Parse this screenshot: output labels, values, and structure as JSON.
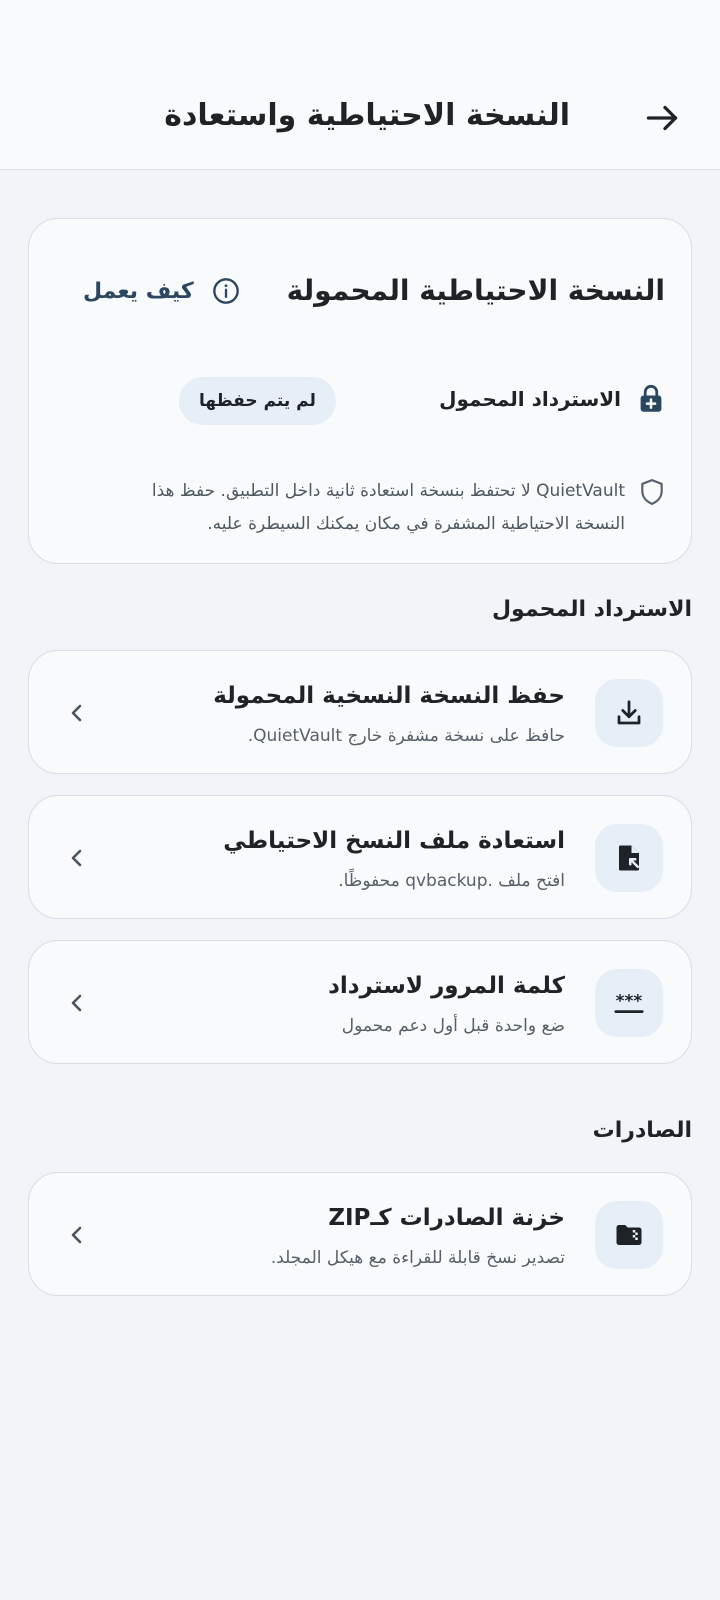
{
  "appbar": {
    "title": "النسخة الاحتياطية واستعادة",
    "back_icon": "arrow-back-icon"
  },
  "portable_card": {
    "title": "النسخة الاحتياطية المحمولة",
    "how_it_works": "كيف يعمل",
    "recovery_label": "الاسترداد المحمول",
    "status": "لم يتم حفظها",
    "note": "QuietVault لا تحتفظ بنسخة استعادة ثانية داخل التطبيق. حفظ هذا النسخة الاحتياطية المشفرة في مكان يمكنك السيطرة عليه."
  },
  "sections": {
    "portable_recovery": "الاسترداد المحمول",
    "exports": "الصادرات"
  },
  "actions": [
    {
      "title": "حفظ النسخة النسخية المحمولة",
      "subtitle": "حافظ على نسخة مشفرة خارج QuietVault.",
      "icon": "download-icon"
    },
    {
      "title": "استعادة ملف النسخ الاحتياطي",
      "subtitle": "افتح ملف .qvbackup محفوظًا.",
      "icon": "file-restore-icon"
    },
    {
      "title": "كلمة المرور لاسترداد",
      "subtitle": "ضع واحدة قبل أول دعم محمول",
      "icon": "password-icon"
    },
    {
      "title": "خزنة الصادرات كـZIP",
      "subtitle": "تصدير نسخ قابلة للقراءة مع هيكل المجلد.",
      "icon": "folder-zip-icon"
    }
  ],
  "colors": {
    "background": "#f1f5f9",
    "card": "#f8fafc",
    "accent_soft": "#e6eff8",
    "link": "#2b4760"
  }
}
